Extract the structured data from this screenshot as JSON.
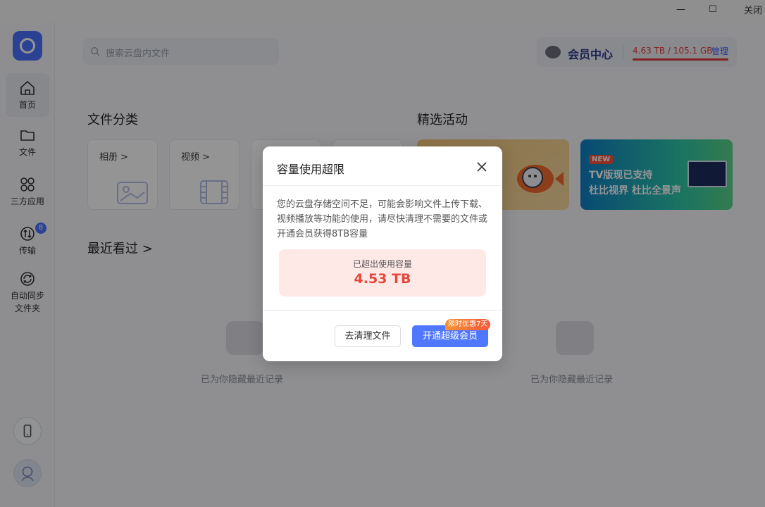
{
  "window": {
    "minimize_glyph": "—",
    "maximize_glyph": "☐",
    "close_label": "关闭"
  },
  "sidebar": {
    "items": [
      {
        "label": "首页",
        "icon": "home-icon"
      },
      {
        "label": "文件",
        "icon": "folder-icon"
      },
      {
        "label": "三方应用",
        "icon": "apps-icon"
      },
      {
        "label": "传输",
        "icon": "transfer-icon",
        "badge": "8"
      },
      {
        "label": "自动同步文件夹",
        "icon": "sync-icon"
      }
    ]
  },
  "search": {
    "placeholder": "搜索云盘内文件"
  },
  "vip": {
    "title": "会员中心",
    "usage": "4.63 TB / 105.1 GB",
    "manage": "管理"
  },
  "categories": {
    "title": "文件分类",
    "items": [
      "相册 >",
      "视频 >"
    ]
  },
  "activities": {
    "title": "精选活动",
    "promo2": {
      "tag": "NEW",
      "line1": "TV版现已支持",
      "line2": "杜比视界 杜比全景声"
    }
  },
  "recent": {
    "title": "最近看过 >",
    "hidden_text": "已为你隐藏最近记录"
  },
  "modal": {
    "title": "容量使用超限",
    "body": "您的云盘存储空间不足，可能会影响文件上传下载、视频播放等功能的使用，请尽快清理不需要的文件或开通会员获得8TB容量",
    "exceed_caption": "已超出使用容量",
    "exceed_value": "4.53 TB",
    "clean_button": "去清理文件",
    "vip_button": "开通超级会员",
    "vip_tag": "限时优惠7天"
  },
  "colors": {
    "accent": "#4f77ff",
    "danger": "#e5483c"
  }
}
